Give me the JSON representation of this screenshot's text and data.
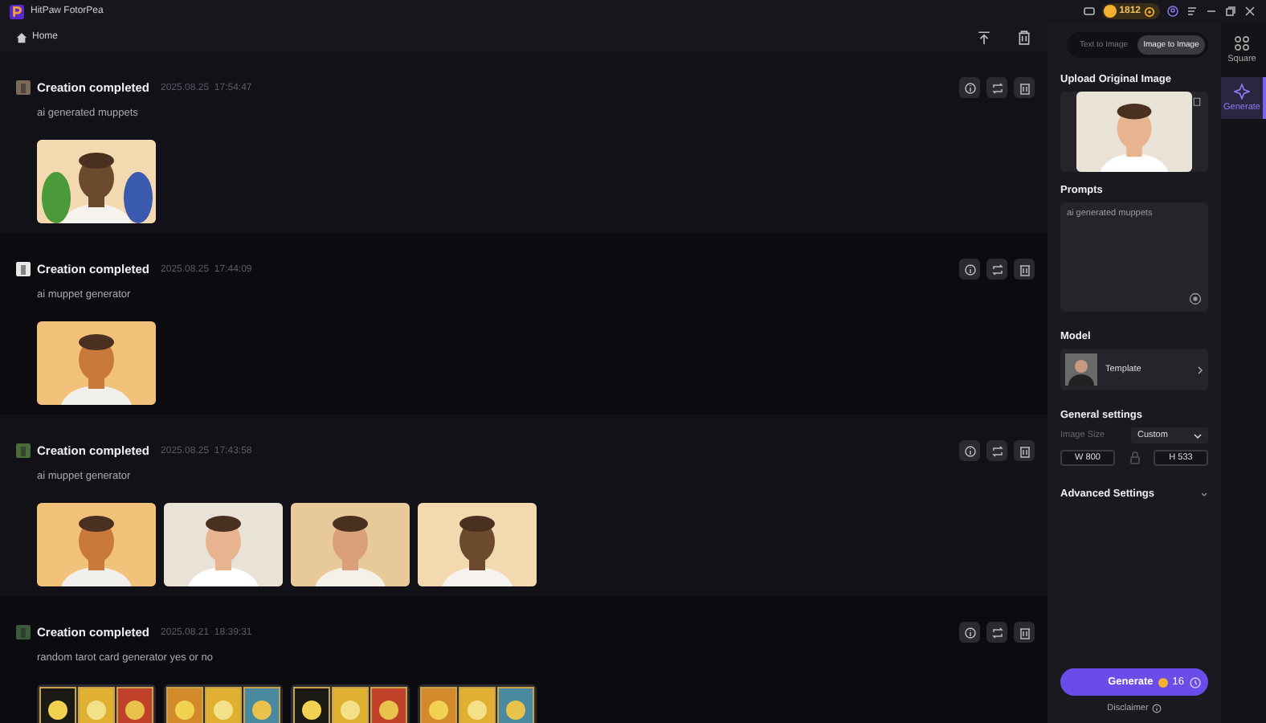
{
  "window": {
    "title": "HitPaw FotorPea",
    "credits": "1812"
  },
  "toolbar": {
    "home": "Home"
  },
  "records": [
    {
      "title": "Creation completed",
      "date": "2025.08.25",
      "time": "17:54:47",
      "prompt": "ai generated muppets"
    },
    {
      "title": "Creation completed",
      "date": "2025.08.25",
      "time": "17:44:09",
      "prompt": "ai muppet generator"
    },
    {
      "title": "Creation completed",
      "date": "2025.08.25",
      "time": "17:43:58",
      "prompt": "ai muppet generator"
    },
    {
      "title": "Creation completed",
      "date": "2025.08.21",
      "time": "18:39:31",
      "prompt": "random tarot card generator yes or no"
    }
  ],
  "panel": {
    "tabs": [
      {
        "label": "Text to Image",
        "selected": false
      },
      {
        "label": "Image to Image",
        "selected": true
      }
    ],
    "upload_label": "Upload Original Image",
    "prompts_label": "Prompts",
    "prompt_value": "ai generated muppets",
    "model_label": "Model",
    "model_name": "Template",
    "general_label": "General settings",
    "size_label": "Image Size",
    "size_value": "Custom",
    "width": "W 800",
    "height": "H 533",
    "advanced_label": "Advanced Settings",
    "generate": "Generate",
    "cost": "16",
    "disclaimer": "Disclaimer"
  },
  "rail": [
    {
      "label": "Square",
      "selected": false
    },
    {
      "label": "Generate",
      "selected": true
    }
  ]
}
